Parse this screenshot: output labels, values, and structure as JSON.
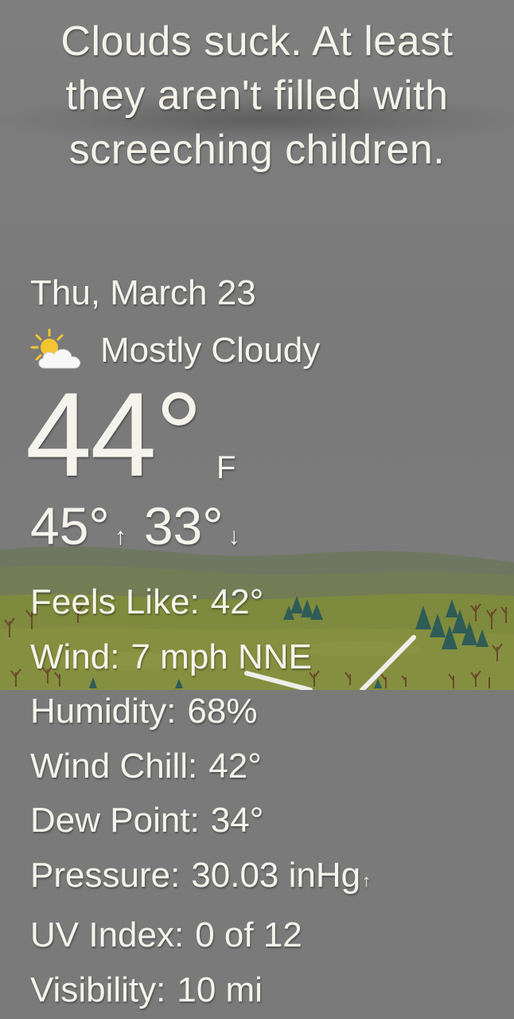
{
  "headline": {
    "line1": "Clouds suck. At least",
    "line2": "they aren't filled with",
    "line3": "screeching children."
  },
  "date": "Thu, March 23",
  "condition": {
    "icon": "partly-cloudy-sun-icon",
    "label": "Mostly Cloudy"
  },
  "temperature": {
    "current": "44°",
    "unit": "F",
    "high": "45°",
    "low": "33°",
    "high_arrow": "↑",
    "low_arrow": "↓"
  },
  "details": [
    {
      "label": "Feels Like:",
      "value": "42°"
    },
    {
      "label": "Wind:",
      "value": "7 mph NNE"
    },
    {
      "label": "Humidity:",
      "value": "68%"
    },
    {
      "label": "Wind Chill:",
      "value": "42°"
    },
    {
      "label": "Dew Point:",
      "value": "34°"
    },
    {
      "label": "Pressure:",
      "value": "30.03 inHg",
      "trend": "↑"
    },
    {
      "label": "UV Index:",
      "value": "0 of 12"
    },
    {
      "label": "Visibility:",
      "value": "10 mi"
    }
  ],
  "colors": {
    "sky": "#7b7b7b",
    "hills": "#6f7d4e",
    "grass": "#7f8a3c",
    "text": "#f4f4ec",
    "trees_dark": "#2f5c57"
  }
}
